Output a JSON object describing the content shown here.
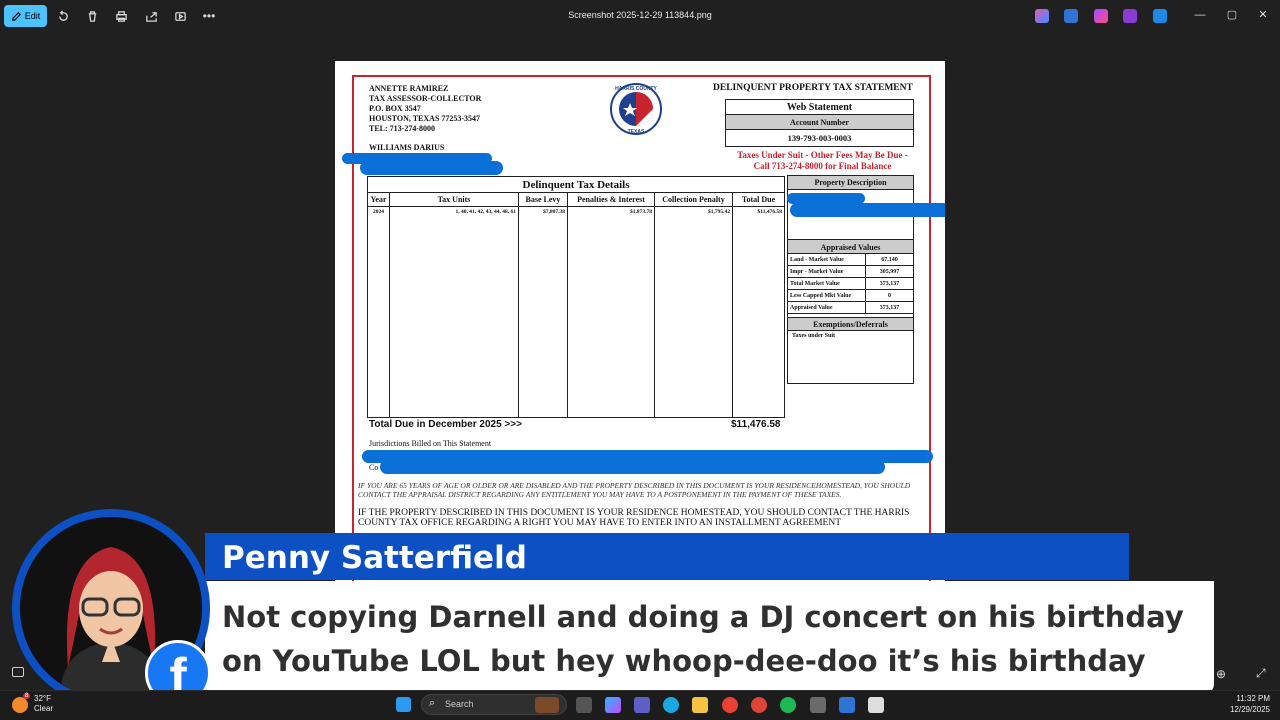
{
  "toolbar": {
    "edit_label": "Edit",
    "title": "Screenshot 2025-12-29 113844.png",
    "more": "•••"
  },
  "document": {
    "assessor_lines": [
      "ANNETTE RAMIREZ",
      "TAX ASSESSOR-COLLECTOR",
      "P.O. BOX 3547",
      "HOUSTON, TEXAS 77253-3547",
      "TEL: 713-274-8000"
    ],
    "owner": "WILLIAMS DARIUS",
    "seal_top": "HARRIS COUNTY",
    "seal_bottom": "TEXAS",
    "statement_title": "DELINQUENT PROPERTY TAX STATEMENT",
    "web_statement": "Web Statement",
    "account_label": "Account Number",
    "account_number": "139-793-003-0003",
    "suit_notice": "Taxes Under Suit - Other Fees May Be Due - Call 713-274-8000 for Final Balance",
    "details_title": "Delinquent Tax Details",
    "columns": [
      "Year",
      "Tax Units",
      "Base Levy",
      "Penalties & Interest",
      "Collection Penalty",
      "Total Due"
    ],
    "row": [
      "2024",
      "1, 40, 41, 42, 43, 44, 48, 61",
      "$7,807.38",
      "$1,873.78",
      "$1,795.42",
      "$11,476.58"
    ],
    "total_label": "Total Due in December 2025 >>>",
    "total_value": "$11,476.58",
    "jurisdictions": "Jurisdictions Billed on This Statement",
    "co_prefix": "Co",
    "property_description": "Property Description",
    "appraised_title": "Appraised Values",
    "appraised": [
      {
        "k": "Land - Market Value",
        "v": "67,140"
      },
      {
        "k": "Impr - Market Value",
        "v": "305,997"
      },
      {
        "k": "Total Market Value",
        "v": "373,137"
      },
      {
        "k": "Less Capped Mkt Value",
        "v": "0"
      },
      {
        "k": "Appraised Value",
        "v": "373,137"
      }
    ],
    "exemptions_title": "Exemptions/Deferrals",
    "exemptions_value": "Taxes under Suit",
    "notice_italic": "IF YOU ARE 65 YEARS OF AGE OR OLDER OR ARE DISABLED AND THE PROPERTY DESCRIBED IN THIS DOCUMENT IS YOUR RESIDENCEHOMESTEAD, YOU SHOULD CONTACT THE APPRAISAL DISTRICT REGARDING ANY ENTITLEMENT YOU MAY HAVE TO A POSTPONEMENT IN THE PAYMENT OF THESE TAXES.",
    "notice_main": "IF THE PROPERTY DESCRIBED IN THIS DOCUMENT IS YOUR RESIDENCE HOMESTEAD, YOU SHOULD CONTACT THE HARRIS COUNTY TAX OFFICE REGARDING A RIGHT YOU MAY HAVE TO ENTER INTO AN INSTALLMENT AGREEMENT"
  },
  "overlay": {
    "name": "Penny Satterfield",
    "message": "Not copying Darnell and doing a DJ concert on his birthday on YouTube LOL but hey whoop-dee-doo it’s his birthday",
    "fb_glyph": "f"
  },
  "taskbar": {
    "temp": "32°F",
    "condition": "Clear",
    "badge": "8",
    "search_placeholder": "Search",
    "time": "11:32 PM",
    "date": "12/29/2025"
  },
  "colors": {
    "accent": "#4cc2ff",
    "doc_red": "#c8242f",
    "scribble": "#0a6fd6",
    "banner_blue": "#0c50c4",
    "facebook": "#1877f2"
  }
}
